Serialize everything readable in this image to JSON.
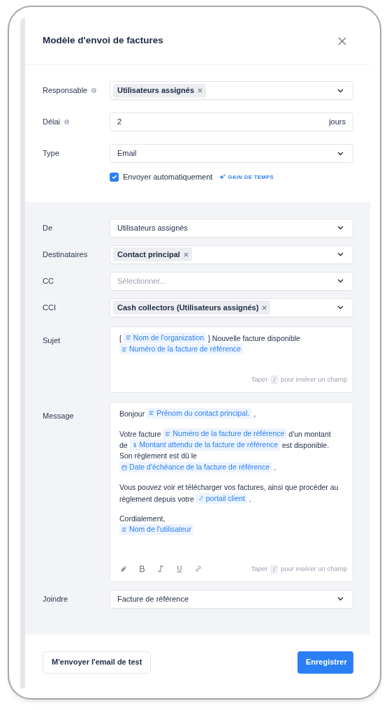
{
  "modal": {
    "title": "Modèle d'envoi de factures"
  },
  "settings": [
    {
      "label": "Responsable",
      "info": true,
      "kind": "multiselect",
      "chips": [
        "Utilisateurs assignés"
      ]
    },
    {
      "label": "Délai",
      "info": true,
      "kind": "number",
      "value": "2",
      "suffix": "jours"
    },
    {
      "label": "Type",
      "info": false,
      "kind": "select",
      "value": "Email"
    }
  ],
  "auto_send": {
    "label": "Envoyer automatiquement",
    "checked": true,
    "badge": "GAIN DE TEMPS"
  },
  "email": [
    {
      "label": "De",
      "kind": "select",
      "value": "Utilisateurs assignés"
    },
    {
      "label": "Destinataires",
      "kind": "multiselect",
      "chips": [
        "Contact principal"
      ]
    },
    {
      "label": "CC",
      "kind": "select",
      "placeholder": "Sélectionner..."
    },
    {
      "label": "CCI",
      "kind": "multiselect",
      "chips": [
        "Cash collectors (Utilisateurs assignés)"
      ]
    }
  ],
  "subject": {
    "label": "Sujet",
    "paragraphs": [
      [
        {
          "kind": "text",
          "text": "["
        },
        {
          "kind": "var",
          "text": "Nom de l'organization"
        },
        {
          "kind": "text",
          "text": "] Nouvelle facture disponible"
        },
        {
          "kind": "break"
        },
        {
          "kind": "var",
          "text": "Numéro de la facture de référence"
        }
      ]
    ],
    "hint": {
      "before": "Taper",
      "key": "/",
      "after": "pour insérer un champ"
    }
  },
  "message": {
    "label": "Message",
    "paragraphs": [
      [
        {
          "kind": "text",
          "text": "Bonjour"
        },
        {
          "kind": "var",
          "text": "Prénom du contact principal."
        },
        {
          "kind": "text",
          "text": ","
        }
      ],
      [
        {
          "kind": "text",
          "text": "Votre facture"
        },
        {
          "kind": "var",
          "text": "Numéro de la facture de référence"
        },
        {
          "kind": "text",
          "text": "d'un montant"
        },
        {
          "kind": "break"
        },
        {
          "kind": "text",
          "text": "de"
        },
        {
          "kind": "amount",
          "text": "Montant attendu de la facture de référence"
        },
        {
          "kind": "text",
          "text": "est disponible."
        },
        {
          "kind": "break"
        },
        {
          "kind": "text",
          "text": "Son règlement est dû le"
        },
        {
          "kind": "break"
        },
        {
          "kind": "date",
          "text": "Date d'échéance de la facture de référence"
        },
        {
          "kind": "text",
          "text": "."
        }
      ],
      [
        {
          "kind": "text",
          "text": "Vous pouvez voir et télécharger vos factures, ainsi que procéder au"
        },
        {
          "kind": "break"
        },
        {
          "kind": "text",
          "text": "règlement depuis votre"
        },
        {
          "kind": "link",
          "text": "portail client"
        },
        {
          "kind": "text",
          "text": "."
        }
      ],
      [
        {
          "kind": "text",
          "text": "Cordialement,"
        },
        {
          "kind": "break"
        },
        {
          "kind": "var",
          "text": "Nom de l'utilisateur"
        }
      ]
    ],
    "toolbar": [
      {
        "kind": "attach"
      },
      {
        "kind": "bold"
      },
      {
        "kind": "italic"
      },
      {
        "kind": "underline"
      },
      {
        "kind": "link"
      }
    ],
    "hint": {
      "before": "Taper",
      "key": "/",
      "after": "pour insérer un champ"
    }
  },
  "attach": {
    "label": "Joindre",
    "kind": "select",
    "value": "Facture de référence"
  },
  "footer": {
    "test_button": "M'envoyer l'email de test",
    "save_button": "Enregistrer"
  }
}
